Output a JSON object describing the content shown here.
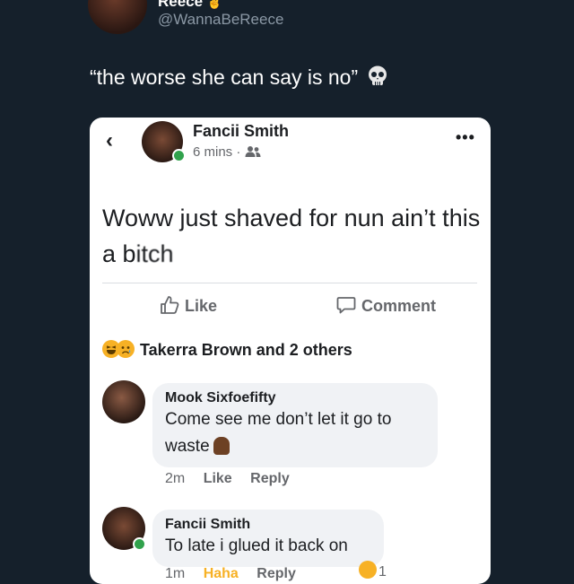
{
  "tweet": {
    "display_name": "Reece",
    "name_emoji": "✌",
    "handle": "@WannaBeReece",
    "more": "···",
    "text": "“the worse she can say is no”"
  },
  "fb_post": {
    "back": "‹",
    "author": "Fancii Smith",
    "time": "6 mins",
    "separator": "·",
    "more": "•••",
    "text": "Woww just shaved for nun ain’t this a b",
    "text_censored_tail": "itch",
    "like_label": "Like",
    "comment_label": "Comment",
    "reactions_text": "Takerra Brown and 2 others"
  },
  "comments": [
    {
      "author": "Mook Sixfoefifty",
      "text": "Come see me don’t let it go to waste",
      "time": "2m",
      "like": "Like",
      "reply": "Reply"
    },
    {
      "author": "Fancii Smith",
      "text": "To late i glued it back on",
      "time": "1m",
      "like": "Haha",
      "reply": "Reply",
      "reaction_count": "1"
    }
  ],
  "colors": {
    "background": "#15202b",
    "card": "#ffffff",
    "bubble": "#f0f2f5",
    "online": "#31a24c",
    "haha": "#f7b125"
  }
}
